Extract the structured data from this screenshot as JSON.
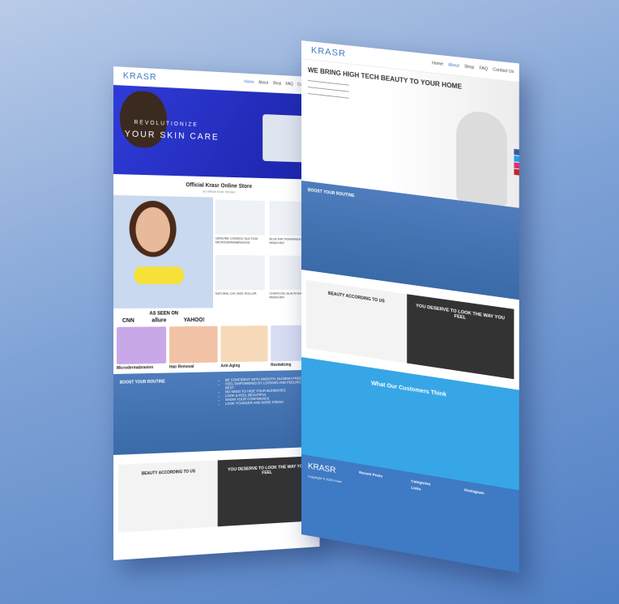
{
  "nav": {
    "logo": "KRASR",
    "items": [
      "Home",
      "About",
      "Shop",
      "FAQ",
      "Contact Us"
    ]
  },
  "left": {
    "hero": {
      "line1": "REVOLUTIONIZE",
      "line2": "YOUR SKIN CARE"
    },
    "store": {
      "title": "Official Krasr Online Store",
      "subtitle": "by Official Krasr Retailer"
    },
    "products": [
      {
        "name": "GENUINE COMEDO SUCTION MICRODERMABRASION"
      },
      {
        "name": "BLUE RAY PERMANENT REMOVER"
      },
      {
        "name": "NATURAL CHI JADE ROLLER"
      },
      {
        "name": "CHARCOAL BLACKHEAD REMOVER"
      }
    ],
    "as_seen": "AS SEEN ON",
    "logos": [
      "CNN",
      "allure",
      "YAHOO!"
    ],
    "categories": [
      {
        "title": "Microdermabrasion",
        "color": "#c9a8e8"
      },
      {
        "title": "Hair Removal",
        "color": "#f2c2a6"
      },
      {
        "title": "Anti-Aging",
        "color": "#f6d9b8"
      },
      {
        "title": "Revitalizing",
        "color": "#d6dcf2"
      }
    ],
    "routine": {
      "title": "BOOST YOUR ROUTINE",
      "items": [
        "BE CONFIDENT WITH SMOOTH, BLEMISH-FREE SKIN",
        "FEEL EMPOWERED BY LOOKING AND FEELING YOUR BEST",
        "NO NEED TO HIDE YOUR BLEMISHES",
        "LOOK & FEEL BEAUTIFUL",
        "SHOW YOUR CONFIDENCE",
        "LOOK YOUNGER AND MORE FRESH"
      ]
    },
    "beauty": {
      "left_title": "BEAUTY ACCORDING TO US",
      "right_title": "YOU DESERVE TO LOOK THE WAY YOU FEEL"
    }
  },
  "right": {
    "headline": "WE BRING HIGH TECH BEAUTY TO YOUR HOME",
    "routine_title": "BOOST YOUR ROUTINE",
    "beauty_left": "BEAUTY ACCORDING TO US",
    "beauty_right": "YOU DESERVE TO LOOK THE WAY YOU FEEL",
    "testimonials": "What Our Customers Think",
    "footer": {
      "logo": "KRASR",
      "recent": "Recent Posts",
      "categories": "Categories",
      "links": "Links",
      "instagram": "#instagram",
      "copyright": "Copyright © 2020 Krasr"
    }
  }
}
